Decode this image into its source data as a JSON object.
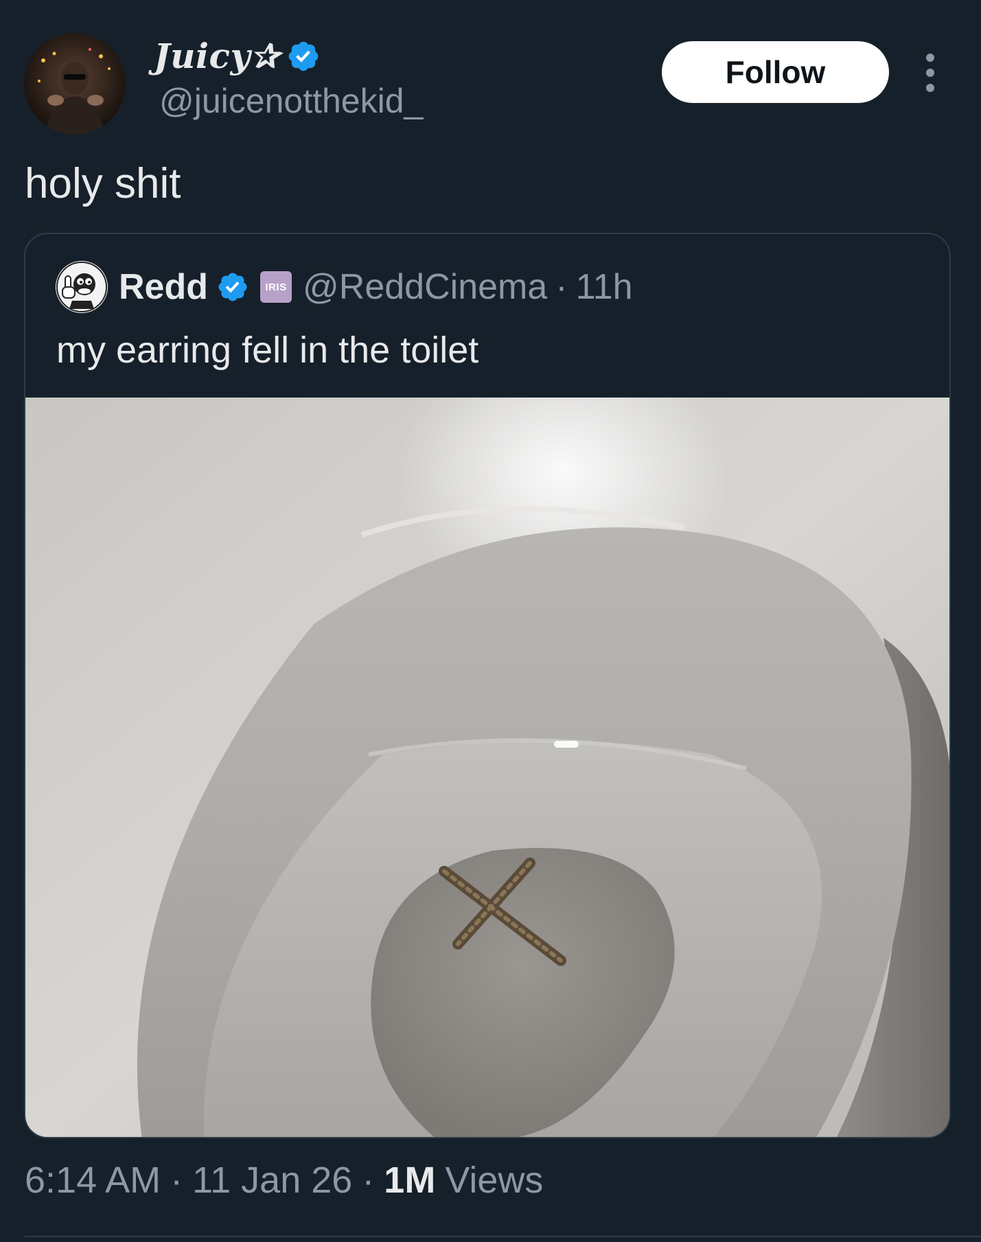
{
  "author": {
    "display_name": "Juicy✰",
    "handle": "@juicenotthekid_",
    "verified": true,
    "avatar_icon": "profile-photo"
  },
  "actions": {
    "follow_label": "Follow",
    "more_icon": "more-vertical-icon"
  },
  "post": {
    "text": "holy shit"
  },
  "quoted_post": {
    "display_name": "Redd",
    "handle": "@ReddCinema",
    "separator": "·",
    "time": "11h",
    "verified": true,
    "affiliate_badge_text": "IRIS",
    "text": "my earring fell in the toilet",
    "media_description_icon": "photo-toilet-cross-earring"
  },
  "meta": {
    "time": "6:14 AM",
    "date": "11 Jan 26",
    "separator": "·",
    "views_count": "1M",
    "views_label": "Views"
  },
  "colors": {
    "background": "#16202a",
    "text_primary": "#e7e9ea",
    "text_secondary": "#8b98a5",
    "verified_blue": "#1d9bf0",
    "border": "#2f3b47"
  }
}
